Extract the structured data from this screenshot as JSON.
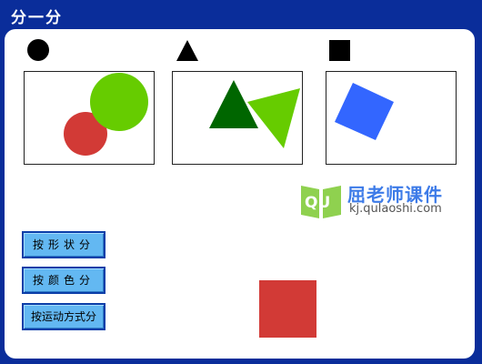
{
  "header": {
    "title": "分一分"
  },
  "legend_symbols": [
    "circle-symbol",
    "triangle-symbol",
    "square-symbol"
  ],
  "groups": [
    {
      "category": "circle",
      "shapes": [
        "red-circle",
        "green-circle"
      ]
    },
    {
      "category": "triangle",
      "shapes": [
        "dark-green-triangle",
        "light-green-triangle"
      ]
    },
    {
      "category": "square",
      "shapes": [
        "blue-square"
      ]
    }
  ],
  "buttons": {
    "by_shape": "按形状分",
    "by_color": "按颜色分",
    "by_motion": "按运动方式分"
  },
  "watermark": {
    "logo_text": "QU",
    "brand": "屈老师课件",
    "url": "kj.qulaoshi.com"
  },
  "colors": {
    "frame": "#0a2d9a",
    "button": "#63b8f2",
    "red": "#d23a36",
    "green": "#66cc00",
    "dark_green": "#006600",
    "blue": "#3366ff"
  }
}
